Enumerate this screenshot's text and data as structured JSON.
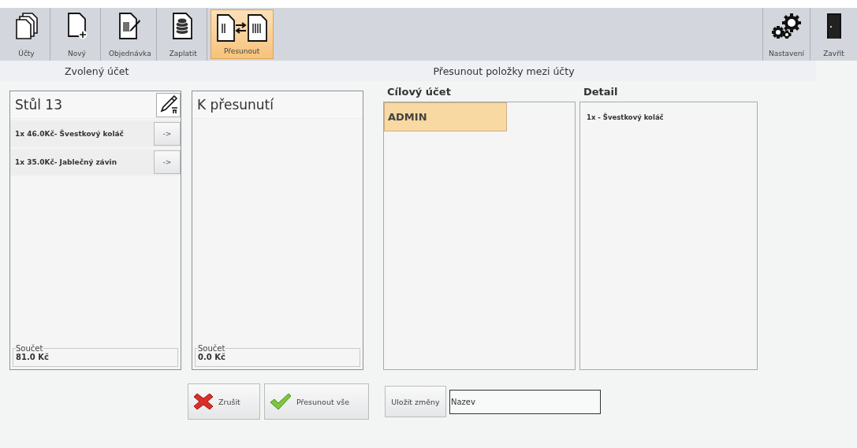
{
  "toolbar": {
    "left": [
      {
        "kind": "accounts",
        "label": "Účty",
        "selected": false
      },
      {
        "kind": "new",
        "label": "Nový",
        "selected": false
      },
      {
        "kind": "order",
        "label": "Objednávka",
        "selected": false
      },
      {
        "kind": "pay",
        "label": "Zaplatit",
        "selected": false
      },
      {
        "kind": "move",
        "label": "Přesunout",
        "selected": true
      }
    ],
    "right": [
      {
        "kind": "settings",
        "label": "Nastavení",
        "selected": false
      },
      {
        "kind": "close",
        "label": "Zavřít",
        "selected": false
      }
    ]
  },
  "header": {
    "left": "Zvolený účet",
    "right": "Přesunout položky mezi účty"
  },
  "source_panel": {
    "title": "Stůl 13",
    "items": [
      {
        "text": "1x 46.0Kč- Švestkový koláč",
        "button": "->"
      },
      {
        "text": "1x 35.0Kč- Jablečný závin",
        "button": "->"
      }
    ],
    "sum_label": "Součet",
    "sum": "81.0 Kč"
  },
  "move_panel": {
    "title": "K přesunutí",
    "sum_label": "Součet",
    "sum": "0.0 Kč"
  },
  "target": {
    "title": "Cílový účet",
    "accounts": [
      {
        "name": "ADMIN",
        "selected": true
      }
    ]
  },
  "detail": {
    "title": "Detail",
    "lines": [
      "1x - Švestkový koláč"
    ]
  },
  "actions": {
    "cancel": "Zrušit",
    "move_all": "Přesunout vše",
    "save": "Uložit změny",
    "name_value": "Nazev"
  }
}
